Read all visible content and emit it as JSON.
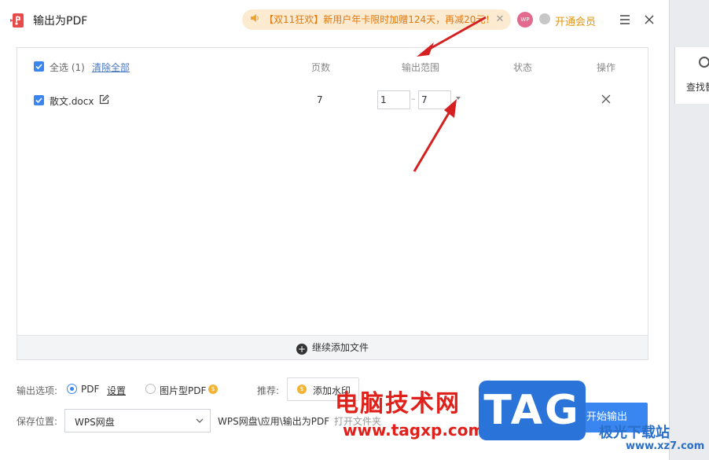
{
  "title": "输出为PDF",
  "promo": {
    "text": "【双11狂欢】新用户年卡限时加赠124天，再减20元！"
  },
  "avatar": "WP",
  "vip_label": "开通会员",
  "table": {
    "select_all_label": "全选 (1)",
    "clear_all": "清除全部",
    "headers": {
      "pages": "页数",
      "range": "输出范围",
      "status": "状态",
      "action": "操作"
    },
    "rows": [
      {
        "name": "散文.docx",
        "pages": "7",
        "range_from": "1",
        "range_to": "7",
        "status": ""
      }
    ]
  },
  "add_more": "继续添加文件",
  "options": {
    "label": "输出选项:",
    "pdf": "PDF",
    "settings": "设置",
    "image_pdf": "图片型PDF",
    "recommend_label": "推荐:",
    "recommend_button": "添加水印"
  },
  "save": {
    "label": "保存位置:",
    "location": "WPS网盘",
    "path": "WPS网盘\\应用\\输出为PDF",
    "open_folder": "打开文件夹"
  },
  "start_button": "开始输出",
  "side_panel": {
    "label": "查找替换"
  },
  "watermark": {
    "cn": "电脑技术网",
    "url": "www.tagxp.com",
    "tag": "TAG",
    "jg": "极光下载站",
    "jg_url": "www.xz7.com"
  },
  "colors": {
    "accent": "#3a86f1",
    "promo_text": "#e2770d",
    "arrow": "#d42020"
  }
}
